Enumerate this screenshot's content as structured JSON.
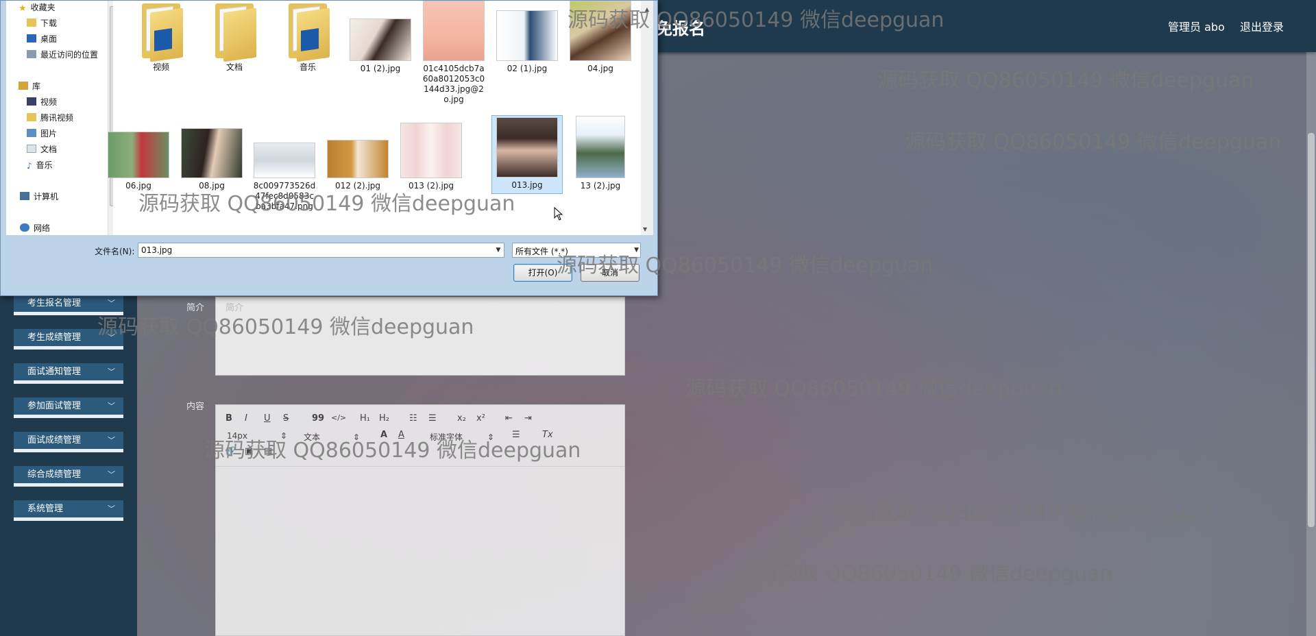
{
  "app": {
    "title": "免报名",
    "user_label": "管理员 abo",
    "logout_label": "退出登录"
  },
  "sidebar": {
    "items": [
      {
        "label": "考生报名管理"
      },
      {
        "label": "考生成绩管理"
      },
      {
        "label": "面试通知管理"
      },
      {
        "label": "参加面试管理"
      },
      {
        "label": "面试成绩管理"
      },
      {
        "label": "综合成绩管理"
      },
      {
        "label": "系统管理"
      }
    ]
  },
  "form": {
    "intro_label": "简介",
    "intro_placeholder": "简介",
    "content_label": "内容",
    "toolbar": {
      "bold": "B",
      "italic": "I",
      "underline": "U",
      "strike": "S",
      "quote": "99",
      "code": "</>",
      "h1": "H₁",
      "h2": "H₂",
      "ol": "☷",
      "ul": "☰",
      "sub": "x₂",
      "sup": "x²",
      "outdent": "⇤",
      "indent": "⇥",
      "size": "14px",
      "type": "文本",
      "font": "标准字体",
      "color": "A",
      "background": "A",
      "align": "☰",
      "clean": "Tx",
      "link": "🔗",
      "image": "▣",
      "video": "▤"
    }
  },
  "dialog": {
    "nav": [
      {
        "label": "收藏夹",
        "icon": "star-icon"
      },
      {
        "label": "下载",
        "icon": "download-folder-icon"
      },
      {
        "label": "桌面",
        "icon": "desktop-icon"
      },
      {
        "label": "最近访问的位置",
        "icon": "recent-places-icon"
      },
      {
        "label": "库",
        "icon": "library-icon"
      },
      {
        "label": "视频",
        "icon": "video-library-icon"
      },
      {
        "label": "腾讯视频",
        "icon": "tencent-video-icon"
      },
      {
        "label": "图片",
        "icon": "pictures-library-icon"
      },
      {
        "label": "文档",
        "icon": "documents-library-icon"
      },
      {
        "label": "音乐",
        "icon": "music-library-icon"
      },
      {
        "label": "计算机",
        "icon": "computer-icon"
      },
      {
        "label": "网络",
        "icon": "network-icon"
      }
    ],
    "files": [
      {
        "name": "视频",
        "kind": "folder"
      },
      {
        "name": "文档",
        "kind": "folder"
      },
      {
        "name": "音乐",
        "kind": "folder"
      },
      {
        "name": "01 (2).jpg",
        "kind": "image"
      },
      {
        "name": "01c4105dcb7a60a8012053c0144d33.jpg@2o.jpg",
        "kind": "image"
      },
      {
        "name": "02 (1).jpg",
        "kind": "image"
      },
      {
        "name": "04.jpg",
        "kind": "image"
      },
      {
        "name": "06.jpg",
        "kind": "image"
      },
      {
        "name": "08.jpg",
        "kind": "image"
      },
      {
        "name": "8c009773526d47fec8d0583cba3bfa47.png",
        "kind": "image"
      },
      {
        "name": "012 (2).jpg",
        "kind": "image"
      },
      {
        "name": "013 (2).jpg",
        "kind": "image"
      },
      {
        "name": "013.jpg",
        "kind": "image",
        "selected": true
      },
      {
        "name": "13 (2).jpg",
        "kind": "image"
      }
    ],
    "filename_label": "文件名(N):",
    "filename_value": "013.jpg",
    "filetype_value": "所有文件 (*.*)",
    "open_label": "打开(O)",
    "cancel_label": "取消"
  },
  "watermark": "源码获取 QQ86050149 微信deepguan",
  "colors": {
    "header_bg": "#1f3a4d",
    "menu_bg": "#2c5a7c",
    "dialog_frame": "#bcd3ea",
    "selection": "#cde6fb"
  }
}
